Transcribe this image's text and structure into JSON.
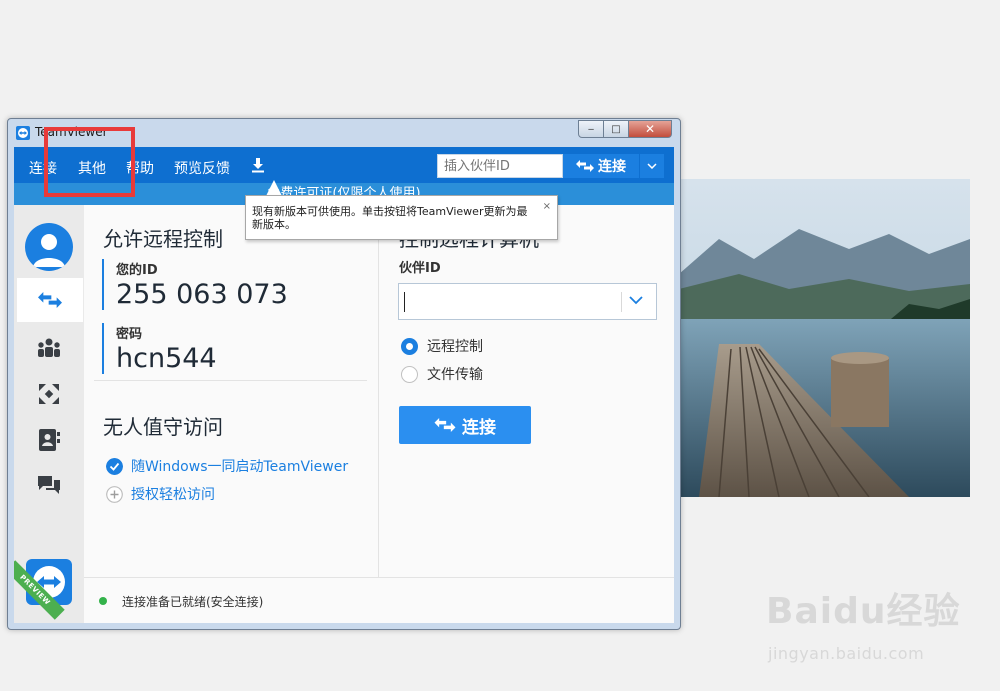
{
  "window": {
    "title": "TeamViewer",
    "controls": {
      "minimize": "‒",
      "maximize": "□",
      "close": "✕"
    }
  },
  "menu": {
    "items": [
      "连接",
      "其他",
      "帮助",
      "预览反馈"
    ],
    "download_icon": "download-icon",
    "partner_id_placeholder": "插入伙伴ID",
    "connect_label": "连接"
  },
  "banner": {
    "text": "免费许可证(仅限个人使用)"
  },
  "tooltip": {
    "text": "现有新版本可供使用。单击按钮将TeamViewer更新为最新版本。",
    "close": "×"
  },
  "sidebar": {
    "items": [
      "remote-control-icon",
      "meeting-icon",
      "augmented-reality-icon",
      "contacts-icon",
      "chat-icon"
    ],
    "preview_ribbon": "PREVIEW"
  },
  "allow_remote": {
    "heading": "允许远程控制",
    "your_id_label": "您的ID",
    "your_id": "255 063 073",
    "password_label": "密码",
    "password": "hcn544"
  },
  "unattended": {
    "heading": "无人值守访问",
    "start_with_windows": "随Windows一同启动TeamViewer",
    "grant_easy_access": "授权轻松访问"
  },
  "control_remote": {
    "heading": "控制远程计算机",
    "partner_id_label": "伙伴ID",
    "partner_id_value": "",
    "options": [
      "远程控制",
      "文件传输"
    ],
    "selected_option": 0,
    "connect_label": "连接"
  },
  "status": {
    "text": "连接准备已就绪(安全连接)",
    "color": "#33b24a"
  },
  "watermark": {
    "logo": "Baidu经验",
    "url": "jingyan.baidu.com"
  },
  "colors": {
    "brand_blue": "#0e6fd0",
    "accent": "#1b7fe0",
    "highlight": "#e83a3a"
  }
}
